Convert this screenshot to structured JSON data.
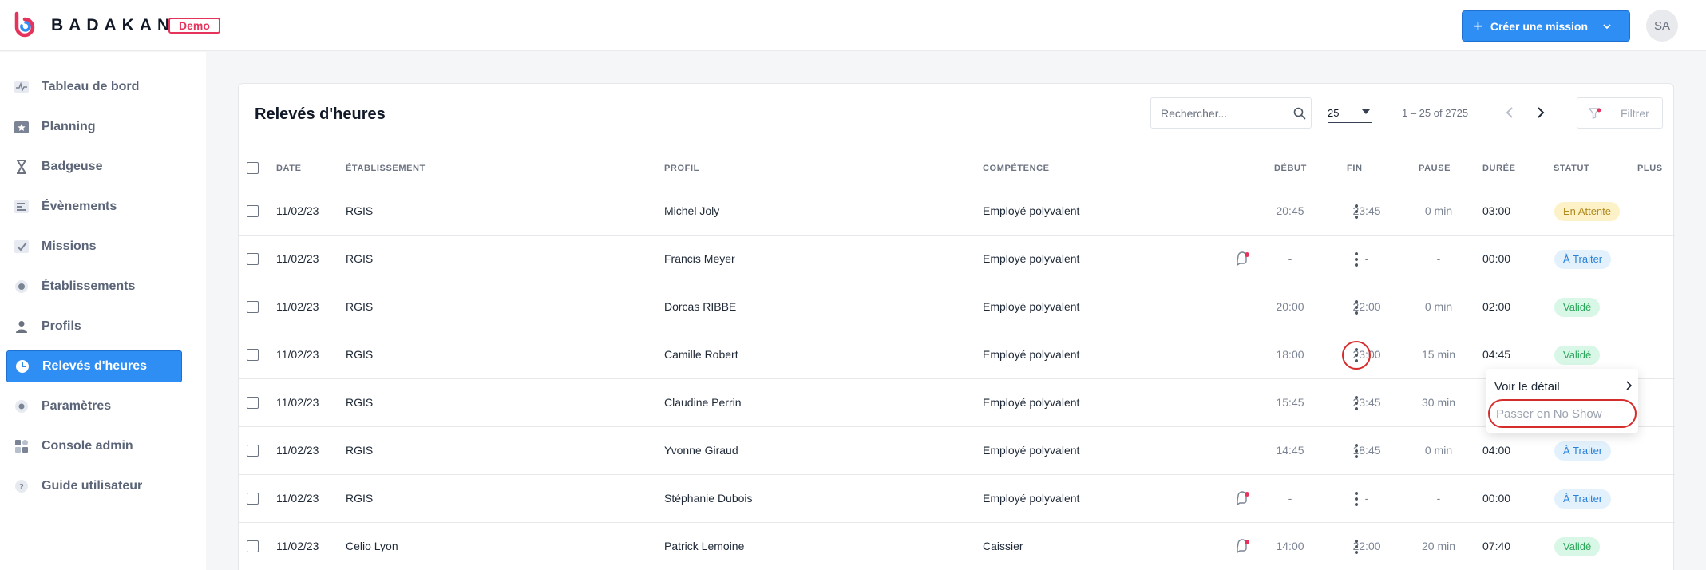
{
  "app": {
    "brand": "BADAKAN",
    "env_badge": "Demo"
  },
  "header": {
    "create_button": "Créer une mission",
    "avatar_initials": "SA"
  },
  "sidebar": {
    "items": [
      {
        "label": "Tableau de bord",
        "icon": "activity-icon"
      },
      {
        "label": "Planning",
        "icon": "calendar-star-icon"
      },
      {
        "label": "Badgeuse",
        "icon": "hourglass-icon"
      },
      {
        "label": "Évènements",
        "icon": "list-icon"
      },
      {
        "label": "Missions",
        "icon": "checkbox-icon"
      },
      {
        "label": "Établissements",
        "icon": "location-icon"
      },
      {
        "label": "Profils",
        "icon": "user-icon"
      },
      {
        "label": "Relevés d'heures",
        "icon": "clock-icon",
        "active": true
      },
      {
        "label": "Paramètres",
        "icon": "gear-icon"
      },
      {
        "label": "Console admin",
        "icon": "grid-icon"
      },
      {
        "label": "Guide utilisateur",
        "icon": "help-icon"
      }
    ]
  },
  "main": {
    "title": "Relevés d'heures",
    "search_placeholder": "Rechercher...",
    "per_page": "25",
    "range": "1 – 25 of 2725",
    "filter_label": "Filtrer",
    "columns": {
      "date": "DATE",
      "etablissement": "ÉTABLISSEMENT",
      "profil": "PROFIL",
      "competence": "COMPÉTENCE",
      "debut": "DÉBUT",
      "fin": "FIN",
      "pause": "PAUSE",
      "duree": "DURÉE",
      "statut": "STATUT",
      "plus": "PLUS"
    },
    "rows": [
      {
        "date": "11/02/23",
        "etablissement": "RGIS",
        "profil": "Michel Joly",
        "competence": "Employé polyvalent",
        "debut": "20:45",
        "fin": "23:45",
        "pause": "0 min",
        "duree": "03:00",
        "statut": "En Attente",
        "status_kind": "attente",
        "notif": false
      },
      {
        "date": "11/02/23",
        "etablissement": "RGIS",
        "profil": "Francis Meyer",
        "competence": "Employé polyvalent",
        "debut": "-",
        "fin": "-",
        "pause": "-",
        "duree": "00:00",
        "statut": "À Traiter",
        "status_kind": "traiter",
        "notif": true
      },
      {
        "date": "11/02/23",
        "etablissement": "RGIS",
        "profil": "Dorcas RIBBE",
        "competence": "Employé polyvalent",
        "debut": "20:00",
        "fin": "22:00",
        "pause": "0 min",
        "duree": "02:00",
        "statut": "Validé",
        "status_kind": "valide",
        "notif": false
      },
      {
        "date": "11/02/23",
        "etablissement": "RGIS",
        "profil": "Camille Robert",
        "competence": "Employé polyvalent",
        "debut": "18:00",
        "fin": "23:00",
        "pause": "15 min",
        "duree": "04:45",
        "statut": "Validé",
        "status_kind": "valide",
        "notif": false,
        "highlighted_menu": true
      },
      {
        "date": "11/02/23",
        "etablissement": "RGIS",
        "profil": "Claudine Perrin",
        "competence": "Employé polyvalent",
        "debut": "15:45",
        "fin": "23:45",
        "pause": "30 min",
        "duree": "",
        "statut": "",
        "status_kind": "",
        "notif": false
      },
      {
        "date": "11/02/23",
        "etablissement": "RGIS",
        "profil": "Yvonne Giraud",
        "competence": "Employé polyvalent",
        "debut": "14:45",
        "fin": "18:45",
        "pause": "0 min",
        "duree": "04:00",
        "statut": "À Traiter",
        "status_kind": "traiter",
        "notif": false
      },
      {
        "date": "11/02/23",
        "etablissement": "RGIS",
        "profil": "Stéphanie Dubois",
        "competence": "Employé polyvalent",
        "debut": "-",
        "fin": "-",
        "pause": "-",
        "duree": "00:00",
        "statut": "À Traiter",
        "status_kind": "traiter",
        "notif": true
      },
      {
        "date": "11/02/23",
        "etablissement": "Celio Lyon",
        "profil": "Patrick Lemoine",
        "competence": "Caissier",
        "debut": "14:00",
        "fin": "22:00",
        "pause": "20 min",
        "duree": "07:40",
        "statut": "Validé",
        "status_kind": "valide",
        "notif": true
      }
    ],
    "context_menu": {
      "item_detail": "Voir le détail",
      "item_no_show": "Passer en No Show"
    }
  },
  "colors": {
    "primary": "#2f8ef4",
    "brand_red": "#e5335b",
    "highlight_red": "#d62c2c",
    "status_attente": "#b08a1d",
    "status_traiter": "#2a82d8",
    "status_valide": "#2ba65c"
  }
}
